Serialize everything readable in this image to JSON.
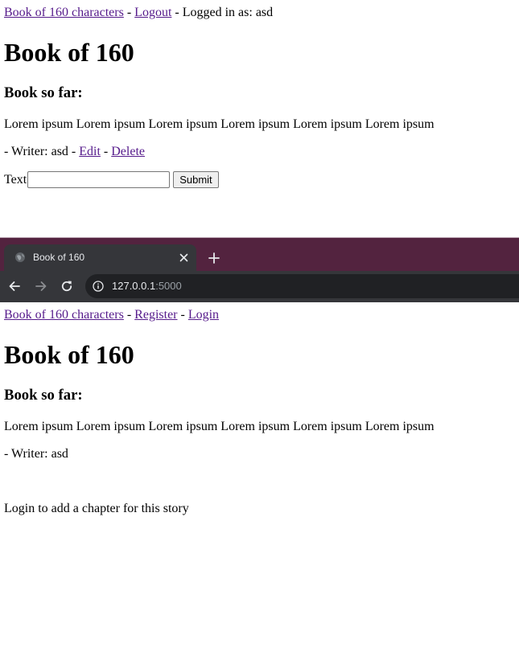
{
  "top_page": {
    "nav": {
      "home_link": "Book of 160 characters",
      "separator_1": " - ",
      "logout_link": "Logout",
      "logged_in_text": " - Logged in as: asd"
    },
    "title": "Book of 160",
    "section_heading": "Book so far:",
    "story_text": "Lorem ipsum Lorem ipsum Lorem ipsum Lorem ipsum Lorem ipsum Lorem ipsum",
    "writer": {
      "prefix": "- Writer: asd - ",
      "edit_link": "Edit",
      "separator": " - ",
      "delete_link": "Delete"
    },
    "form": {
      "text_label": "Text",
      "text_value": "",
      "submit_label": "Submit"
    }
  },
  "browser": {
    "tab_title": "Book of 160",
    "url_host": "127.0.0.1",
    "url_port": ":5000",
    "colors": {
      "tab_strip": "#53233f",
      "toolbar": "#35363a",
      "omnibox": "#202124"
    }
  },
  "bottom_page": {
    "nav": {
      "home_link": "Book of 160 characters",
      "separator_1": " - ",
      "register_link": "Register",
      "separator_2": " - ",
      "login_link": "Login"
    },
    "title": "Book of 160",
    "section_heading": "Book so far:",
    "story_text": "Lorem ipsum Lorem ipsum Lorem ipsum Lorem ipsum Lorem ipsum Lorem ipsum",
    "writer_line": "- Writer: asd",
    "login_note": "Login to add a chapter for this story"
  },
  "colors": {
    "link": "#551a8b",
    "text": "#000000",
    "background": "#ffffff"
  }
}
